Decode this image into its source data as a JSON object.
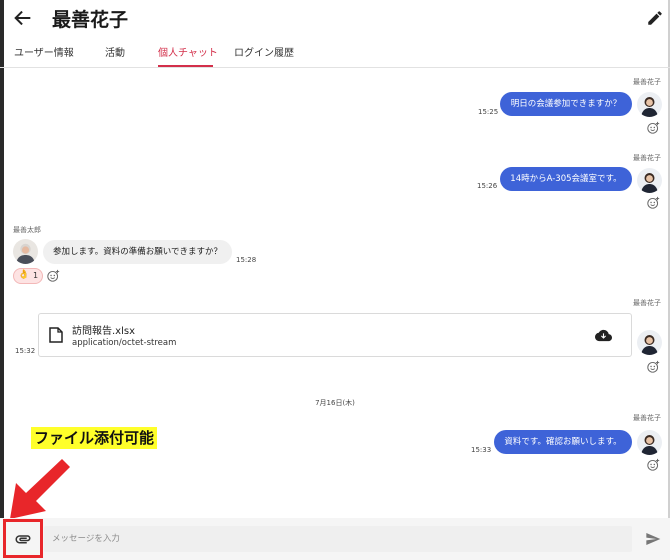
{
  "header": {
    "title": "最善花子"
  },
  "tabs": [
    {
      "label": "ユーザー情報"
    },
    {
      "label": "活動"
    },
    {
      "label": "個人チャット"
    },
    {
      "label": "ログイン履歴"
    }
  ],
  "messages": [
    {
      "sender": "最善花子",
      "text": "明日の会議参加できますか？",
      "time": "15:25"
    },
    {
      "sender": "最善花子",
      "text": "14時からA-305会議室です。",
      "time": "15:26"
    },
    {
      "sender": "最善太郎",
      "text": "参加します。資料の準備お願いできますか？",
      "time": "15:28",
      "reaction": {
        "emoji": "👌",
        "count": "1"
      }
    },
    {
      "sender": "最善花子",
      "time": "15:32",
      "file": {
        "name": "訪問報告.xlsx",
        "type": "application/octet-stream"
      }
    },
    {
      "sender": "最善花子",
      "text": "資料です。確認お願いします。",
      "time": "15:33"
    }
  ],
  "date_separator": "7月16日(木)",
  "annotation": "ファイル添付可能",
  "input": {
    "placeholder": "メッセージを入力",
    "value": ""
  },
  "colors": {
    "accent": "#d32f4a",
    "bubble_out": "#3e63d8",
    "annotation_bg": "#ffff2a",
    "highlight": "#e8262a"
  },
  "icons": {
    "back": "arrow-left-icon",
    "edit": "pencil-icon",
    "emoji": "add-reaction-icon",
    "file": "document-icon",
    "download": "cloud-download-icon",
    "attach": "paperclip-icon",
    "send": "send-icon"
  }
}
